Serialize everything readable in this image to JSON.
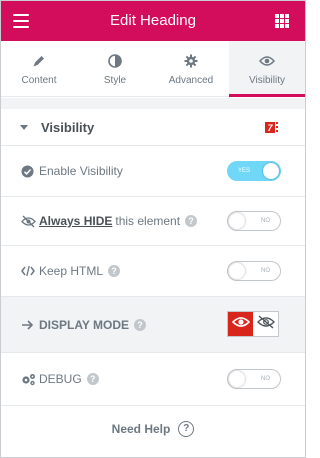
{
  "header": {
    "title": "Edit Heading",
    "accent_color": "#d30c5c"
  },
  "tabs": [
    {
      "label": "Content",
      "icon": "pencil-icon",
      "active": false
    },
    {
      "label": "Style",
      "icon": "contrast-icon",
      "active": false
    },
    {
      "label": "Advanced",
      "icon": "gear-icon",
      "active": false
    },
    {
      "label": "Visibility",
      "icon": "eye-icon",
      "active": true
    }
  ],
  "section": {
    "title": "Visibility",
    "badge_icon": "plugin-logo-icon",
    "badge_text": "7"
  },
  "rows": {
    "enable_visibility": {
      "label": "Enable Visibility",
      "icon": "check-circle-icon",
      "toggle": "YES",
      "on": true
    },
    "always_hide": {
      "label_strong": "Always HIDE",
      "label_rest": "this element",
      "icon": "eye-slash-icon",
      "help": "?",
      "toggle": "NO",
      "on": false
    },
    "keep_html": {
      "label": "Keep HTML",
      "icon": "code-icon",
      "help": "?",
      "toggle": "NO",
      "on": false
    },
    "display_mode": {
      "label": "DISPLAY MODE",
      "icon": "arrow-right-icon",
      "help": "?",
      "options": [
        "eye-icon",
        "eye-slash-icon"
      ],
      "selected": "eye-icon",
      "selected_color": "#d9261c"
    },
    "debug": {
      "label": "DEBUG",
      "icon": "cogs-icon",
      "help": "?",
      "toggle": "NO",
      "on": false
    }
  },
  "footer": {
    "need_help": "Need Help",
    "help_icon_text": "?"
  },
  "colors": {
    "toggle_on": "#71d7f7",
    "panel_bg": "#f1f3f5"
  }
}
